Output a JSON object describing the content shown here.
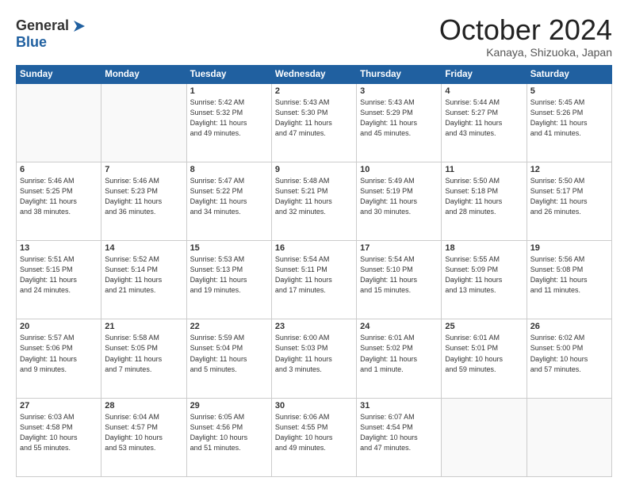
{
  "header": {
    "logo_line1": "General",
    "logo_line2": "Blue",
    "month": "October 2024",
    "location": "Kanaya, Shizuoka, Japan"
  },
  "weekdays": [
    "Sunday",
    "Monday",
    "Tuesday",
    "Wednesday",
    "Thursday",
    "Friday",
    "Saturday"
  ],
  "rows": [
    [
      {
        "day": "",
        "info": ""
      },
      {
        "day": "",
        "info": ""
      },
      {
        "day": "1",
        "info": "Sunrise: 5:42 AM\nSunset: 5:32 PM\nDaylight: 11 hours\nand 49 minutes."
      },
      {
        "day": "2",
        "info": "Sunrise: 5:43 AM\nSunset: 5:30 PM\nDaylight: 11 hours\nand 47 minutes."
      },
      {
        "day": "3",
        "info": "Sunrise: 5:43 AM\nSunset: 5:29 PM\nDaylight: 11 hours\nand 45 minutes."
      },
      {
        "day": "4",
        "info": "Sunrise: 5:44 AM\nSunset: 5:27 PM\nDaylight: 11 hours\nand 43 minutes."
      },
      {
        "day": "5",
        "info": "Sunrise: 5:45 AM\nSunset: 5:26 PM\nDaylight: 11 hours\nand 41 minutes."
      }
    ],
    [
      {
        "day": "6",
        "info": "Sunrise: 5:46 AM\nSunset: 5:25 PM\nDaylight: 11 hours\nand 38 minutes."
      },
      {
        "day": "7",
        "info": "Sunrise: 5:46 AM\nSunset: 5:23 PM\nDaylight: 11 hours\nand 36 minutes."
      },
      {
        "day": "8",
        "info": "Sunrise: 5:47 AM\nSunset: 5:22 PM\nDaylight: 11 hours\nand 34 minutes."
      },
      {
        "day": "9",
        "info": "Sunrise: 5:48 AM\nSunset: 5:21 PM\nDaylight: 11 hours\nand 32 minutes."
      },
      {
        "day": "10",
        "info": "Sunrise: 5:49 AM\nSunset: 5:19 PM\nDaylight: 11 hours\nand 30 minutes."
      },
      {
        "day": "11",
        "info": "Sunrise: 5:50 AM\nSunset: 5:18 PM\nDaylight: 11 hours\nand 28 minutes."
      },
      {
        "day": "12",
        "info": "Sunrise: 5:50 AM\nSunset: 5:17 PM\nDaylight: 11 hours\nand 26 minutes."
      }
    ],
    [
      {
        "day": "13",
        "info": "Sunrise: 5:51 AM\nSunset: 5:15 PM\nDaylight: 11 hours\nand 24 minutes."
      },
      {
        "day": "14",
        "info": "Sunrise: 5:52 AM\nSunset: 5:14 PM\nDaylight: 11 hours\nand 21 minutes."
      },
      {
        "day": "15",
        "info": "Sunrise: 5:53 AM\nSunset: 5:13 PM\nDaylight: 11 hours\nand 19 minutes."
      },
      {
        "day": "16",
        "info": "Sunrise: 5:54 AM\nSunset: 5:11 PM\nDaylight: 11 hours\nand 17 minutes."
      },
      {
        "day": "17",
        "info": "Sunrise: 5:54 AM\nSunset: 5:10 PM\nDaylight: 11 hours\nand 15 minutes."
      },
      {
        "day": "18",
        "info": "Sunrise: 5:55 AM\nSunset: 5:09 PM\nDaylight: 11 hours\nand 13 minutes."
      },
      {
        "day": "19",
        "info": "Sunrise: 5:56 AM\nSunset: 5:08 PM\nDaylight: 11 hours\nand 11 minutes."
      }
    ],
    [
      {
        "day": "20",
        "info": "Sunrise: 5:57 AM\nSunset: 5:06 PM\nDaylight: 11 hours\nand 9 minutes."
      },
      {
        "day": "21",
        "info": "Sunrise: 5:58 AM\nSunset: 5:05 PM\nDaylight: 11 hours\nand 7 minutes."
      },
      {
        "day": "22",
        "info": "Sunrise: 5:59 AM\nSunset: 5:04 PM\nDaylight: 11 hours\nand 5 minutes."
      },
      {
        "day": "23",
        "info": "Sunrise: 6:00 AM\nSunset: 5:03 PM\nDaylight: 11 hours\nand 3 minutes."
      },
      {
        "day": "24",
        "info": "Sunrise: 6:01 AM\nSunset: 5:02 PM\nDaylight: 11 hours\nand 1 minute."
      },
      {
        "day": "25",
        "info": "Sunrise: 6:01 AM\nSunset: 5:01 PM\nDaylight: 10 hours\nand 59 minutes."
      },
      {
        "day": "26",
        "info": "Sunrise: 6:02 AM\nSunset: 5:00 PM\nDaylight: 10 hours\nand 57 minutes."
      }
    ],
    [
      {
        "day": "27",
        "info": "Sunrise: 6:03 AM\nSunset: 4:58 PM\nDaylight: 10 hours\nand 55 minutes."
      },
      {
        "day": "28",
        "info": "Sunrise: 6:04 AM\nSunset: 4:57 PM\nDaylight: 10 hours\nand 53 minutes."
      },
      {
        "day": "29",
        "info": "Sunrise: 6:05 AM\nSunset: 4:56 PM\nDaylight: 10 hours\nand 51 minutes."
      },
      {
        "day": "30",
        "info": "Sunrise: 6:06 AM\nSunset: 4:55 PM\nDaylight: 10 hours\nand 49 minutes."
      },
      {
        "day": "31",
        "info": "Sunrise: 6:07 AM\nSunset: 4:54 PM\nDaylight: 10 hours\nand 47 minutes."
      },
      {
        "day": "",
        "info": ""
      },
      {
        "day": "",
        "info": ""
      }
    ]
  ]
}
